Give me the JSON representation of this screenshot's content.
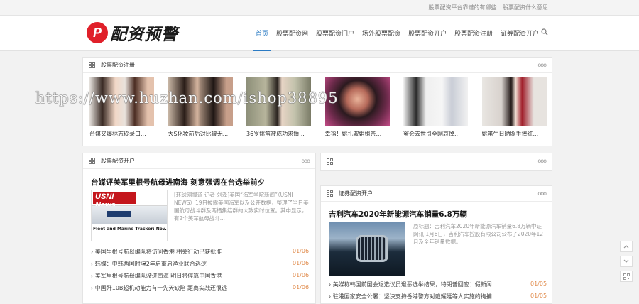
{
  "topbar": {
    "links": [
      "股票配资平台靠谱的有哪些",
      "股票配资什么意思"
    ]
  },
  "logo": {
    "mark": "P",
    "text": "配资预警"
  },
  "nav": {
    "items": [
      "首页",
      "股票配资网",
      "股票配资门户",
      "场外股票配资",
      "股票配资开户",
      "股票配资注册",
      "证券配资开户"
    ],
    "active_index": 0
  },
  "section_photos": {
    "title": "股票配资注册",
    "items": [
      {
        "caption": "台媒又爆林志玲录口..."
      },
      {
        "caption": "大S化妆前后对比被无..."
      },
      {
        "caption": "36岁姚笛被成功求婚..."
      },
      {
        "caption": "幸福！姚扎双姐姐亲..."
      },
      {
        "caption": "蜜会去世引全网哀悼..."
      },
      {
        "caption": "姚笛生日晒照手捧红..."
      }
    ]
  },
  "section_left": {
    "title": "股票配资开户",
    "headline": "台媒评美军里根号航母进南海 刻意强调在台选举前夕",
    "image_caption": "USNI News",
    "image_sub": "Fleet and Marine Tracker: Nov. 19,",
    "summary": "[环球网报道 记者 刘泽]美国“海军学院新闻”（USNI NEWS）19日披露美国海军以及公开数据，整理了当日美国航母战斗群及两栖集结群的大致实时位置。其中显示，有2个美军航母战斗...",
    "list": [
      {
        "text": "美国里根号航母编队将访问香港 相关行动已获批准",
        "date": "01/06"
      },
      {
        "text": "韩媒：中韩两国时隔2年启重启渔业联合巡逻",
        "date": "01/06"
      },
      {
        "text": "美军里根号航母编队驶进南海 明日将停靠中国香港",
        "date": "01/06"
      },
      {
        "text": "中国歼10B超机动能力有一先天缺陷 距离实战还很远",
        "date": "01/06"
      }
    ]
  },
  "section_right_top": {
    "title": ""
  },
  "section_right": {
    "title": "证券配资开户",
    "headline": "吉利汽车2020年新能源汽车销量6.8万辆",
    "summary": "原标题：吉利汽车2020年新能源汽车销量6.8万辆中证网讯 1月6日，吉利汽车控股有限公司公布了2020年12月及全年销量数据。",
    "list": [
      {
        "text": "美媒称韩国前国会退选议员退恶选举结果，特朗普回应：假新闻",
        "date": "01/05"
      },
      {
        "text": "驻港国家安全公署：坚决支持香港警方对戴耀廷等人实施的拘捕",
        "date": "01/05"
      }
    ]
  },
  "side_buttons": [
    "chevron-up",
    "chevron-down",
    "qrcode"
  ],
  "watermark": "https://www.huzhan.com/ishop38895"
}
